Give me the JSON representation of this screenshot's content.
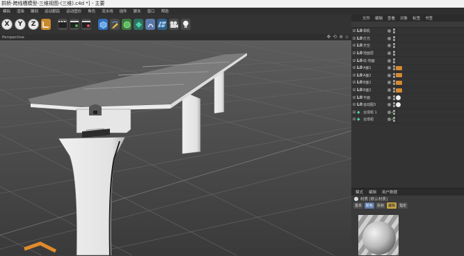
{
  "window": {
    "title": "拱桥-跨线槽模型-三维视图-(三维).c4d *] - 主要"
  },
  "menu": [
    "模拟",
    "渲染",
    "雕刻",
    "运动跟踪",
    "运动图形",
    "角色",
    "流水线",
    "插件",
    "脚本",
    "窗口",
    "帮助"
  ],
  "toolbar": {
    "axis_x": "X",
    "axis_y": "Y",
    "axis_z": "Z"
  },
  "viewport": {
    "label": "Perspective"
  },
  "object_manager": {
    "tabs": [
      "文件",
      "编辑",
      "查看",
      "对象",
      "标签",
      "书签"
    ],
    "items": [
      {
        "name": "相机",
        "tag": ""
      },
      {
        "name": "灯光",
        "tag": ""
      },
      {
        "name": "天空",
        "tag": ""
      },
      {
        "name": "地面层",
        "tag": ""
      },
      {
        "name": "纹-地面",
        "tag": ""
      },
      {
        "name": "A面1",
        "tag": "orange"
      },
      {
        "name": "A面2",
        "tag": "orange"
      },
      {
        "name": "B面1",
        "tag": "orange"
      },
      {
        "name": "B面2",
        "tag": "orange"
      },
      {
        "name": "平面",
        "tag": "white"
      },
      {
        "name": "运动图3",
        "tag": "white"
      },
      {
        "name": "合成组 1",
        "tag": "check"
      },
      {
        "name": "合成组",
        "tag": "check"
      }
    ]
  },
  "attribute_manager": {
    "tabs": [
      "模式",
      "编辑",
      "用户数据"
    ],
    "title": "材质 [默认材质]",
    "subtabs": [
      "基本",
      "颜色",
      "反射",
      "编辑",
      "指定"
    ]
  },
  "colors": {
    "accent_blue": "#5b79a8",
    "tag_orange": "#d48a34",
    "ok_green": "#7fd36a"
  }
}
